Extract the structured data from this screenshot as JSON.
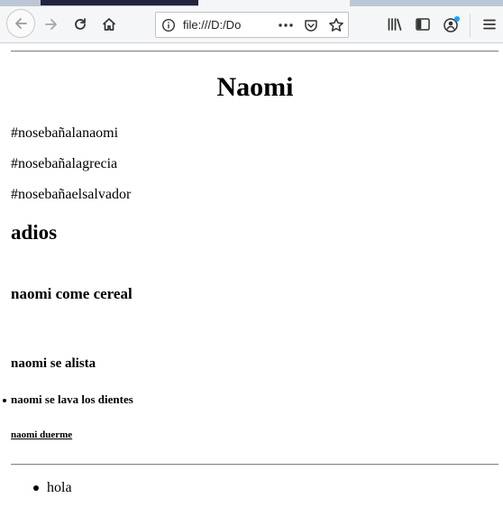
{
  "browser": {
    "url": "file:///D:/Do",
    "icons": [
      "back-arrow-icon",
      "forward-arrow-icon",
      "reload-icon",
      "home-icon",
      "info-icon",
      "more-dots-icon",
      "pocket-icon",
      "star-icon",
      "library-icon",
      "sidebar-icon",
      "account-icon",
      "menu-icon"
    ]
  },
  "page": {
    "title": "Naomi",
    "paragraphs": [
      "#nosebañalanaomi",
      "#nosebañalagrecia",
      "#nosebañaelsalvador"
    ],
    "h2": "adios",
    "h3": "naomi come cereal",
    "h4": "naomi se alista",
    "h5": "naomi se lava los dientes",
    "h6": "naomi duerme",
    "list": [
      "hola"
    ]
  }
}
